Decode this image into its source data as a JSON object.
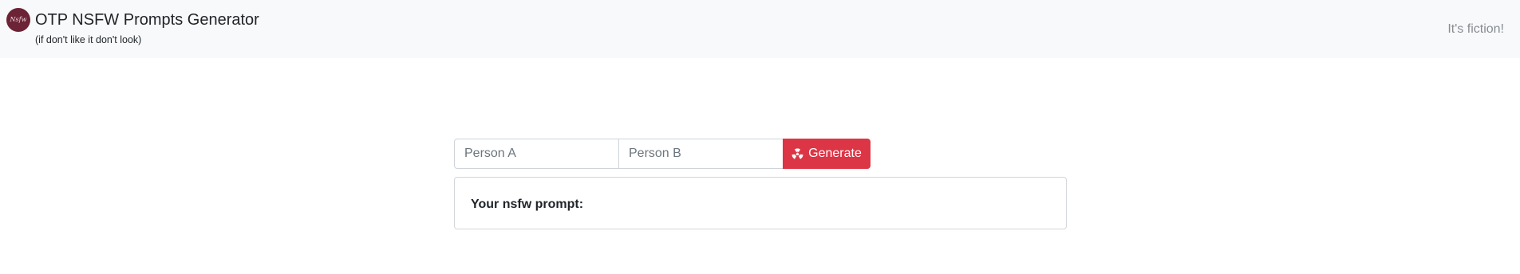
{
  "navbar": {
    "logo_text": "Nsfw",
    "title": "OTP NSFW Prompts Generator",
    "subtitle": "(if don't like it don't look)",
    "right_link": "It's fiction!"
  },
  "form": {
    "person_a_placeholder": "Person A",
    "person_a_value": "",
    "person_b_placeholder": "Person B",
    "person_b_value": "",
    "generate_label": "Generate",
    "generate_icon": "radiation-icon",
    "button_color": "#dc3545"
  },
  "result": {
    "label": "Your nsfw prompt:"
  },
  "colors": {
    "navbar_bg": "#f8f9fa",
    "logo_bg": "#6b2335",
    "accent": "#dc3545"
  }
}
